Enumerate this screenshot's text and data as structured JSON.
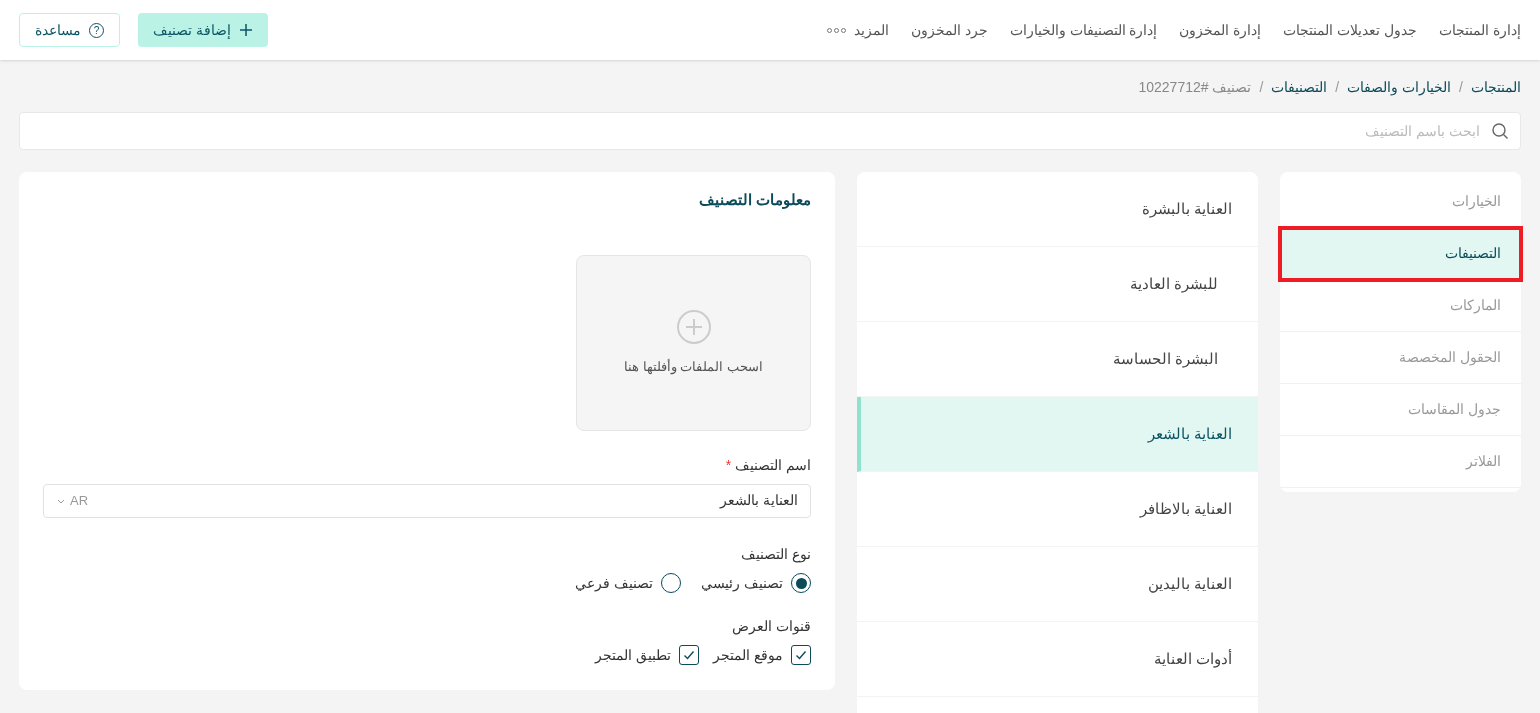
{
  "top_nav": [
    {
      "label": "إدارة المنتجات"
    },
    {
      "label": "جدول تعديلات المنتجات"
    },
    {
      "label": "إدارة المخزون"
    },
    {
      "label": "إدارة التصنيفات والخيارات"
    },
    {
      "label": "جرد المخزون"
    },
    {
      "label": "المزيد",
      "kind": "more"
    }
  ],
  "actions": [
    {
      "label": "إضافة تصنيف",
      "kind": "primary"
    },
    {
      "label": "مساعدة",
      "kind": "help"
    }
  ],
  "breadcrumb_separator": "/",
  "help_glyph": "?",
  "breadcrumb": [
    {
      "label": "المنتجات",
      "current": false
    },
    {
      "label": "الخيارات والصفات",
      "current": false
    },
    {
      "label": "التصنيفات",
      "current": false
    },
    {
      "label": "تصنيف #10227712",
      "current": true
    }
  ],
  "search": {
    "placeholder": "ابحث باسم التصنيف"
  },
  "sidebar": {
    "items": [
      {
        "label": "الخيارات",
        "selected": false,
        "highlighted": false
      },
      {
        "label": "التصنيفات",
        "selected": true,
        "highlighted": true
      },
      {
        "label": "الماركات",
        "selected": false,
        "highlighted": false
      },
      {
        "label": "الحقول المخصصة",
        "selected": false,
        "highlighted": false
      },
      {
        "label": "جدول المقاسات",
        "selected": false,
        "highlighted": false
      },
      {
        "label": "الفلاتر",
        "selected": false,
        "highlighted": false
      }
    ]
  },
  "category_tree": [
    {
      "label": "العناية بالبشرة",
      "selected": false,
      "children": [
        {
          "label": "للبشرة العادية",
          "selected": false
        },
        {
          "label": "البشرة الحساسة",
          "selected": false
        }
      ]
    },
    {
      "label": "العناية بالشعر",
      "selected": true
    },
    {
      "label": "العناية بالاظافر",
      "selected": false
    },
    {
      "label": "العناية باليدين",
      "selected": false
    },
    {
      "label": "أدوات العناية",
      "selected": false
    }
  ],
  "form": {
    "title": "معلومات التصنيف",
    "upload": {
      "text": "اسحب الملفات وأفلتها هنا"
    },
    "name_field": {
      "label": "اسم التصنيف",
      "required_mark": "*",
      "value": "العناية بالشعر",
      "language": "AR"
    },
    "type": {
      "label": "نوع التصنيف",
      "options": [
        {
          "label": "تصنيف رئيسي",
          "selected": true
        },
        {
          "label": "تصنيف فرعي",
          "selected": false
        }
      ]
    },
    "channels": {
      "label": "قنوات العرض",
      "options": [
        {
          "label": "موقع المتجر",
          "checked": true
        },
        {
          "label": "تطبيق المتجر",
          "checked": true
        }
      ]
    }
  }
}
